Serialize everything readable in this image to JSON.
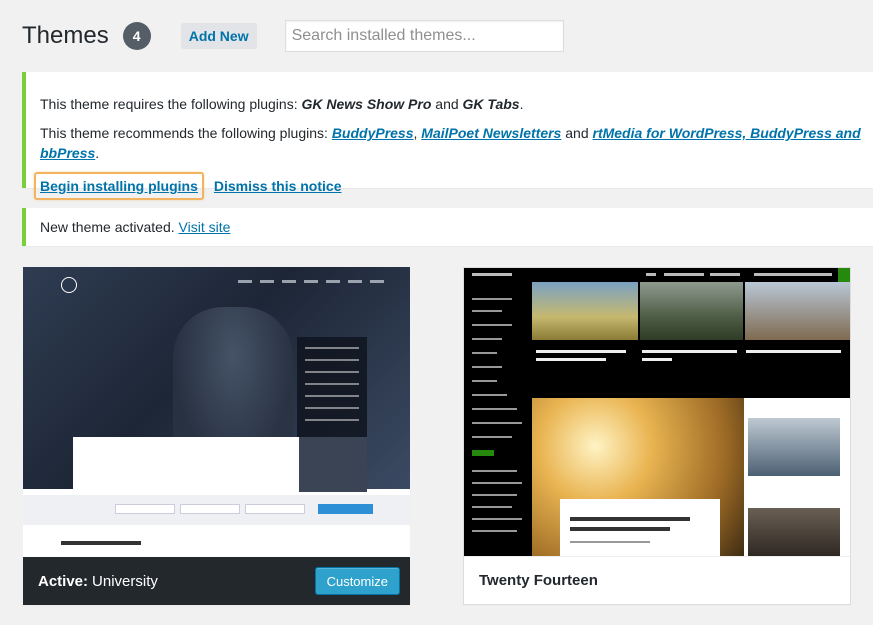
{
  "header": {
    "title": "Themes",
    "count": "4",
    "add_new_label": "Add New",
    "search_placeholder": "Search installed themes..."
  },
  "plugin_notice": {
    "requires_text": "This theme requires the following plugins: ",
    "required_plugin_1": "GK News Show Pro",
    "and_1": " and ",
    "required_plugin_2": "GK Tabs",
    "period_1": ".",
    "recommends_text": "This theme recommends the following plugins: ",
    "recommended_plugin_1": "BuddyPress",
    "comma_1": ", ",
    "recommended_plugin_2": "MailPoet Newsletters",
    "and_2": " and ",
    "recommended_plugin_3": "rtMedia for WordPress, BuddyPress and bbPress",
    "period_2": ".",
    "begin_installing_label": "Begin installing plugins",
    "dismiss_label": "Dismiss this notice"
  },
  "activated_notice": {
    "text": "New theme activated. ",
    "visit_site_label": "Visit site"
  },
  "themes": [
    {
      "active_prefix": "Active:",
      "name": "University",
      "customize_label": "Customize"
    },
    {
      "name": "Twenty Fourteen"
    }
  ],
  "colors": {
    "notice_border": "#7ad03a",
    "link": "#0073aa",
    "highlight": "#f3b35f",
    "active_bar": "#23282d",
    "customize_button": "#2ea2cc"
  }
}
